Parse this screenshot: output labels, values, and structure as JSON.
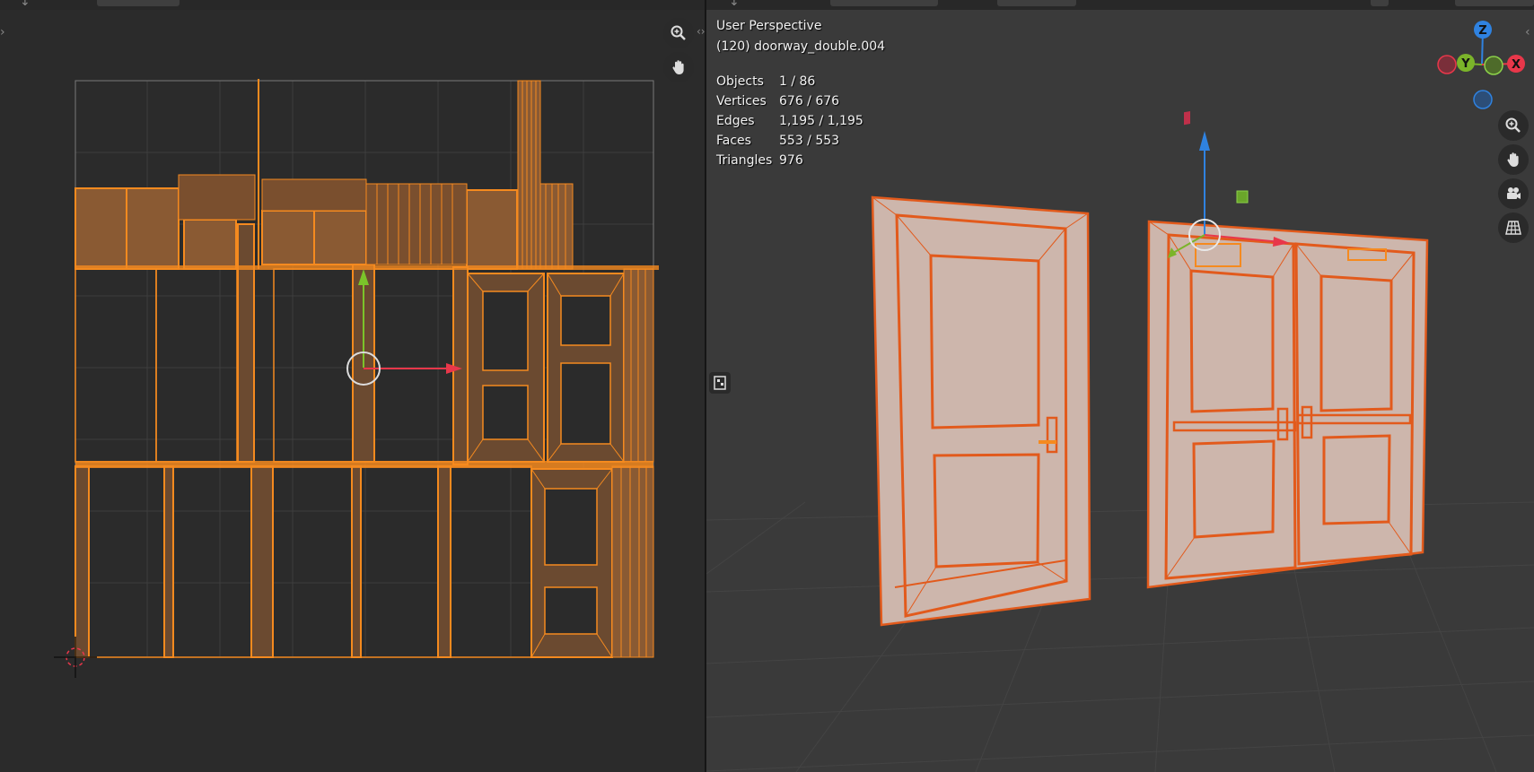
{
  "uv_editor": {
    "zoom_icon": "zoom-icon",
    "pan_icon": "hand-pan-icon",
    "accent": "#f58a1f",
    "fill": "#8a5a33"
  },
  "viewport": {
    "view_name": "User Perspective",
    "object_name": "(120) doorway_double.004",
    "stats": [
      {
        "label": "Objects",
        "value": "1 / 86"
      },
      {
        "label": "Vertices",
        "value": "676 / 676"
      },
      {
        "label": "Edges",
        "value": "1,195 / 1,195"
      },
      {
        "label": "Faces",
        "value": "553 / 553"
      },
      {
        "label": "Triangles",
        "value": "976"
      }
    ],
    "gizmo": {
      "z": "Z",
      "y": "Y",
      "x": "X"
    },
    "tools": [
      "zoom-icon",
      "hand-pan-icon",
      "camera-icon",
      "grid-ortho-icon"
    ],
    "colors": {
      "x": "#e8374a",
      "y": "#7bb42a",
      "z": "#2f82e0",
      "mesh_edge": "#e25a1c",
      "mesh_face": "#cdb6ac"
    }
  }
}
